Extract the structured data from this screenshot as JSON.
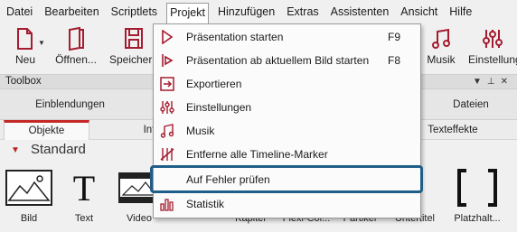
{
  "menubar": {
    "items": [
      "Datei",
      "Bearbeiten",
      "Scriptlets",
      "Projekt",
      "Hinzufügen",
      "Extras",
      "Assistenten",
      "Ansicht",
      "Hilfe"
    ]
  },
  "ribbon": {
    "new": "Neu",
    "open": "Öffnen...",
    "save": "Speichern",
    "music": "Musik",
    "settings": "Einstellungen"
  },
  "toolbox": {
    "title": "Toolbox"
  },
  "tabs_row1": [
    "Einblendungen",
    "Dateien"
  ],
  "tabs_row2": [
    "Objekte",
    "Int",
    "Texteffekte"
  ],
  "section": {
    "label": "Standard"
  },
  "items": [
    "Bild",
    "Text",
    "Video",
    "Kapitel",
    "Flexi-Col...",
    "Partikel",
    "Untertitel",
    "Platzhalt..."
  ],
  "dropdown": {
    "items": [
      {
        "icon": "play-icon",
        "label": "Präsentation starten",
        "shortcut": "F9"
      },
      {
        "icon": "play-from-current-icon",
        "label": "Präsentation ab aktuellem Bild starten",
        "shortcut": "F8"
      },
      {
        "icon": "export-icon",
        "label": "Exportieren",
        "shortcut": ""
      },
      {
        "icon": "settings-sliders-icon",
        "label": "Einstellungen",
        "shortcut": ""
      },
      {
        "icon": "music-icon",
        "label": "Musik",
        "shortcut": ""
      },
      {
        "icon": "remove-markers-icon",
        "label": "Entferne alle Timeline-Marker",
        "shortcut": ""
      },
      {
        "icon": "none",
        "label": "Auf Fehler prüfen",
        "shortcut": ""
      },
      {
        "icon": "statistics-icon",
        "label": "Statistik",
        "shortcut": ""
      }
    ]
  },
  "colors": {
    "accent": "#a51c30",
    "highlight_border": "#1f5e87",
    "tab_active": "#c62828"
  }
}
